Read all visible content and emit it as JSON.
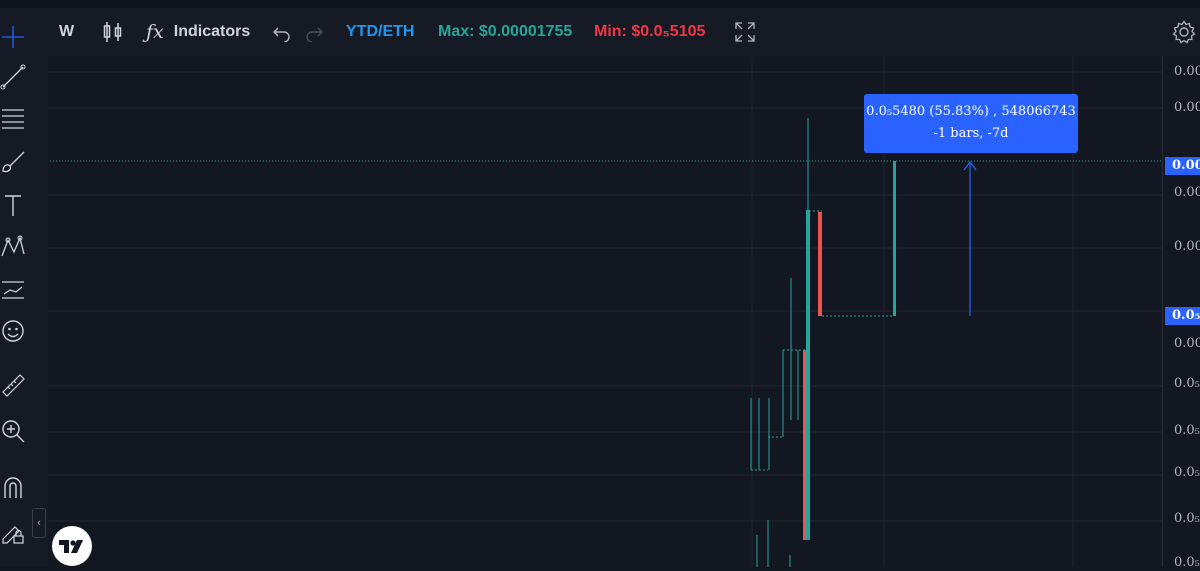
{
  "toolbar": {
    "interval": "W",
    "indicators_label": "Indicators",
    "symbol": "YTD/ETH",
    "max_text": "Max: $0.00001755",
    "min_text": "Min: $0.0₅5105"
  },
  "sidebar": {
    "tools": [
      "crosshair-icon",
      "trend-line-icon",
      "fib-retracement-icon",
      "brush-icon",
      "text-icon",
      "pattern-icon",
      "forecast-icon",
      "emoji-icon",
      "ruler-icon",
      "zoom-in-icon",
      "magnet-icon",
      "lock-drawing-icon"
    ]
  },
  "colors": {
    "up": "#26a69a",
    "down": "#ef5350",
    "accent": "#2962ff",
    "background": "#131722",
    "max": "#26a69a",
    "min": "#f23645",
    "symbol": "#2196f3"
  },
  "price_axis": {
    "labels": [
      "0.00",
      "0.00",
      "0.00",
      "0.00",
      "0.00",
      "0.0₅",
      "0.0₅",
      "0.0₅",
      "0.0₅",
      "0.0₅",
      "0.0₅"
    ],
    "badge_current": "0.00",
    "badge_measure": "0.0₅"
  },
  "measure_tooltip": {
    "line1": "0.0₅5480 (55.83%) , 548066743",
    "line2": "-1 bars, -7d"
  },
  "chart_data": {
    "type": "candlestick",
    "title": "YTD/ETH",
    "max": 1.755e-05,
    "min": 5.105e-06,
    "measure": {
      "change": 5.48e-06,
      "change_percent": 55.83,
      "volume": 548066743,
      "bars": -1,
      "days": -7
    },
    "grid": true
  }
}
